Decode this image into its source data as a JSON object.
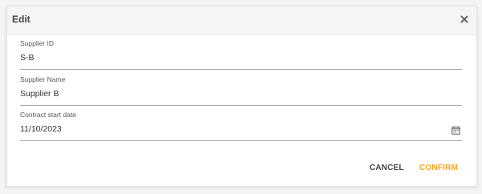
{
  "dialog": {
    "title": "Edit",
    "close_icon": "close-x-icon"
  },
  "fields": {
    "supplier_id": {
      "label": "Supplier ID",
      "value": "S-B"
    },
    "supplier_name": {
      "label": "Supplier Name",
      "value": "Supplier B"
    },
    "contract_start": {
      "label": "Contract start date",
      "value": "11/10/2023",
      "icon": "calendar-icon"
    }
  },
  "actions": {
    "cancel_label": "CANCEL",
    "confirm_label": "CONFIRM"
  },
  "colors": {
    "accent": "#f5a623",
    "header_bg": "#f5f5f5"
  }
}
